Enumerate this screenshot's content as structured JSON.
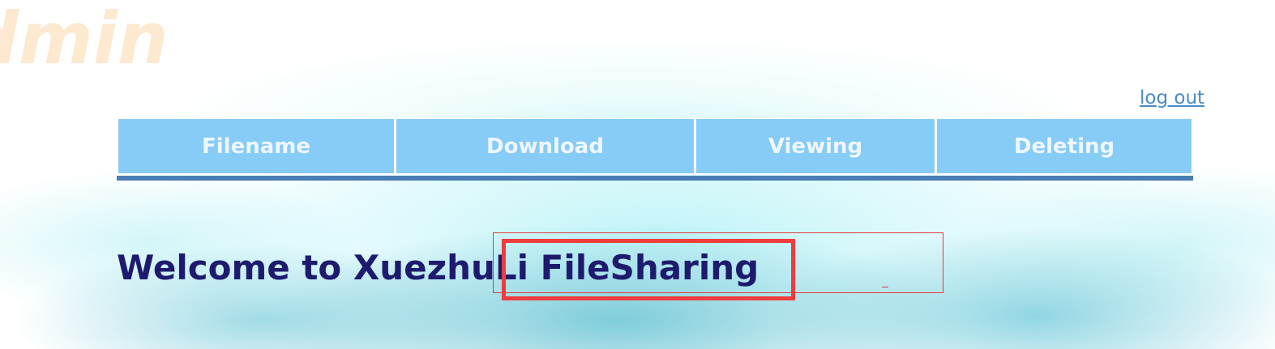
{
  "brand": {
    "watermark_text": "dmin"
  },
  "header": {
    "logout_label": "log out"
  },
  "table": {
    "columns": [
      "Filename",
      "Download",
      "Viewing",
      "Deleting"
    ]
  },
  "main": {
    "welcome_text": "Welcome to XuezhuLi FileSharing"
  },
  "colors": {
    "header_cell_bg": "#87cbf7",
    "header_rule": "#4a7db4",
    "heading_text": "#1e1b6e",
    "link": "#4a8ac6",
    "highlight": "#ef3c3c",
    "watermark": "#fde9cf"
  }
}
